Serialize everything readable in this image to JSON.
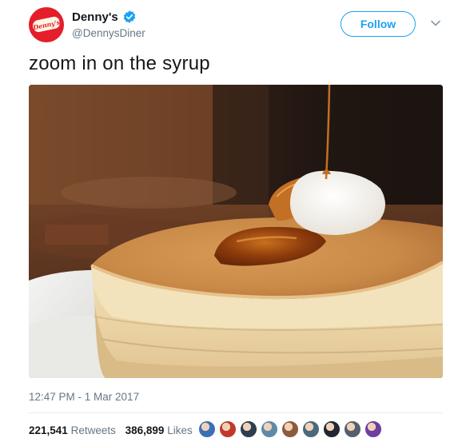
{
  "account": {
    "display_name": "Denny's",
    "handle": "@DennysDiner",
    "avatar_logo_text": "Denny's",
    "verified": true,
    "brand_color": "#e41e2b"
  },
  "actions": {
    "follow_label": "Follow",
    "more_icon": "chevron-down-icon"
  },
  "tweet": {
    "text": "zoom in on the syrup",
    "media": {
      "alt_icon": "photo-pancakes"
    },
    "timestamp": "12:47 PM - 1 Mar 2017"
  },
  "stats": {
    "retweets_count": "221,541",
    "retweets_label": "Retweets",
    "likes_count": "386,899",
    "likes_label": "Likes"
  },
  "likers": [
    {
      "icon": "liker-avatar-1",
      "color": "#3b6fb6"
    },
    {
      "icon": "liker-avatar-2",
      "color": "#c0392b"
    },
    {
      "icon": "liker-avatar-3",
      "color": "#2c3e50"
    },
    {
      "icon": "liker-avatar-4",
      "color": "#5d8aa8"
    },
    {
      "icon": "liker-avatar-5",
      "color": "#8e5a3c"
    },
    {
      "icon": "liker-avatar-6",
      "color": "#4a6a7a"
    },
    {
      "icon": "liker-avatar-7",
      "color": "#222831"
    },
    {
      "icon": "liker-avatar-8",
      "color": "#55606b"
    },
    {
      "icon": "liker-avatar-9",
      "color": "#6c3fa0"
    }
  ],
  "colors": {
    "accent": "#1da1f2",
    "secondary_text": "#657786",
    "primary_text": "#14171a"
  }
}
